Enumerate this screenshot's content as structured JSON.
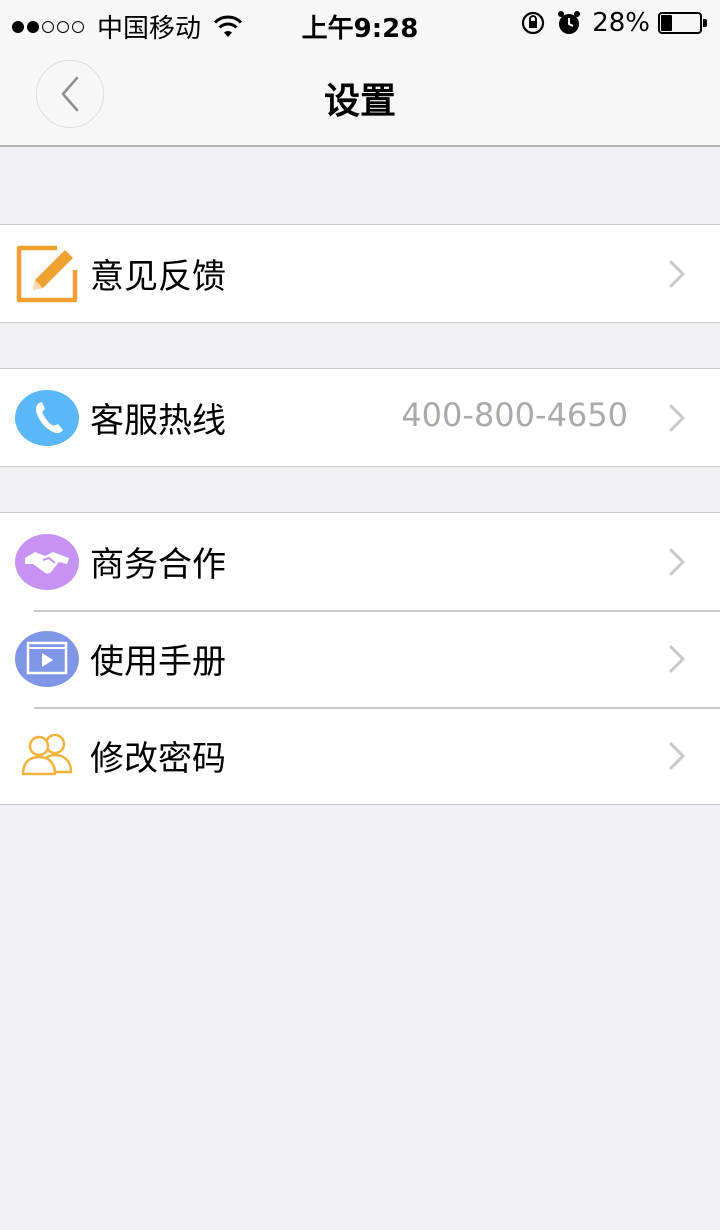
{
  "status_bar": {
    "carrier": "中国移动",
    "time": "上午9:28",
    "battery_percent": "28%",
    "battery_level": 0.28
  },
  "nav": {
    "title": "设置"
  },
  "groups": [
    {
      "items": [
        {
          "label": "意见反馈",
          "icon": "feedback-edit-icon",
          "color": "#f0a030"
        }
      ]
    },
    {
      "items": [
        {
          "label": "客服热线",
          "value": "400-800-4650",
          "icon": "phone-icon",
          "color": "#5ab8f8"
        }
      ]
    },
    {
      "items": [
        {
          "label": "商务合作",
          "icon": "handshake-icon",
          "color": "#c693f5"
        },
        {
          "label": "使用手册",
          "icon": "video-manual-icon",
          "color": "#7f96e6"
        },
        {
          "label": "修改密码",
          "icon": "users-icon",
          "color": "#f4b23c"
        }
      ]
    }
  ]
}
